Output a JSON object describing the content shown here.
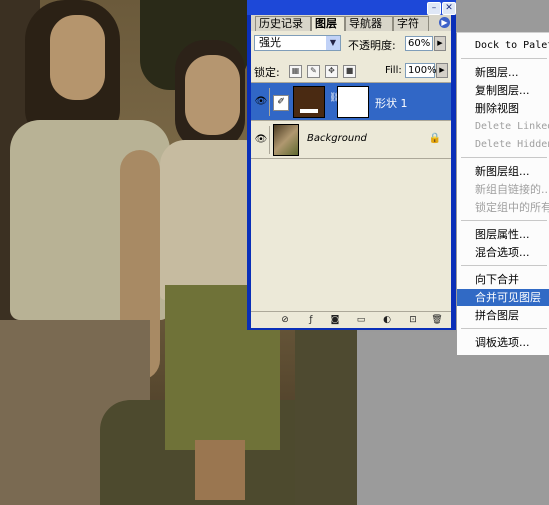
{
  "palette": {
    "tabs": [
      "历史记录",
      "图层",
      "导航器",
      "字符"
    ],
    "active_tab": "图层",
    "blend_mode": "强光",
    "opacity_label": "不透明度:",
    "opacity_value": "60%",
    "lock_label": "锁定:",
    "fill_label": "Fill:",
    "fill_value": "100%",
    "layers": [
      {
        "name": "形状 1",
        "selected": true,
        "thumb_color": "#4a2a12"
      },
      {
        "name": "Background",
        "selected": false,
        "locked": true
      }
    ]
  },
  "menu": {
    "items": [
      {
        "label": "Dock to Palette Well",
        "disabled": false
      },
      {
        "sep": true
      },
      {
        "label": "新图层...",
        "disabled": false
      },
      {
        "label": "复制图层...",
        "disabled": false
      },
      {
        "label": "删除视图",
        "disabled": false
      },
      {
        "label": "Delete Linked Layers",
        "disabled": true
      },
      {
        "label": "Delete Hidden Layers",
        "disabled": true
      },
      {
        "sep": true
      },
      {
        "label": "新图层组...",
        "disabled": false
      },
      {
        "label": "新组自链接的...",
        "disabled": true
      },
      {
        "label": "锁定组中的所有图层...",
        "disabled": true
      },
      {
        "sep": true
      },
      {
        "label": "图层属性...",
        "disabled": false
      },
      {
        "label": "混合选项...",
        "disabled": false
      },
      {
        "sep": true
      },
      {
        "label": "向下合并",
        "disabled": false
      },
      {
        "label": "合并可见图层",
        "disabled": false,
        "highlighted": true
      },
      {
        "label": "拼合图层",
        "disabled": false
      },
      {
        "sep": true
      },
      {
        "label": "调板选项...",
        "disabled": false
      }
    ]
  },
  "colors": {
    "title_blue": "#1d48d8",
    "selection_blue": "#316ac5",
    "panel_bg": "#ece9d8"
  }
}
